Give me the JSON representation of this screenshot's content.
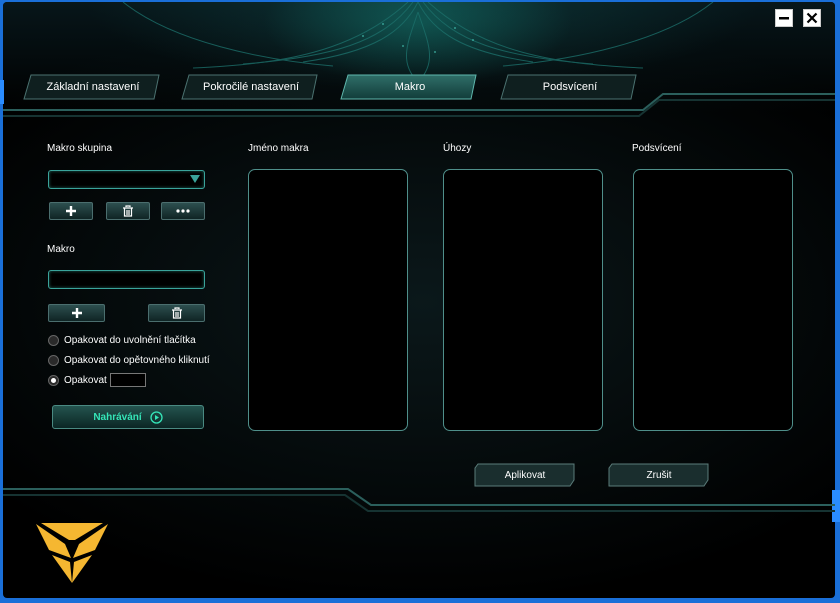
{
  "window": {
    "minimize_icon": "minimize-icon",
    "close_icon": "close-icon"
  },
  "tabs": [
    {
      "label": "Základní nastavení",
      "active": false
    },
    {
      "label": "Pokročilé nastavení",
      "active": false
    },
    {
      "label": "Makro",
      "active": true
    },
    {
      "label": "Podsvícení",
      "active": false
    }
  ],
  "macro_group": {
    "label": "Makro skupina",
    "selected": "",
    "buttons": [
      "add-icon",
      "trash-icon",
      "more-icon"
    ]
  },
  "macro": {
    "label": "Makro",
    "value": "",
    "buttons": [
      "add-icon",
      "trash-icon"
    ]
  },
  "repeat_options": [
    {
      "label": "Opakovat do uvolnění tlačítka",
      "selected": false
    },
    {
      "label": "Opakovat do opětovného kliknutí",
      "selected": false
    },
    {
      "label": "Opakovat",
      "selected": true
    }
  ],
  "record_button": {
    "label": "Nahrávání",
    "icon": "play-icon"
  },
  "columns": {
    "macro_name": "Jméno makra",
    "keystrokes": "Úhozy",
    "backlight": "Podsvícení"
  },
  "actions": {
    "apply": "Aplikovat",
    "cancel": "Zrušit"
  },
  "colors": {
    "accent": "#3aa39a",
    "logo": "#f5b731",
    "record_text": "#35e5b8",
    "outer_border": "#1a6fd8"
  }
}
